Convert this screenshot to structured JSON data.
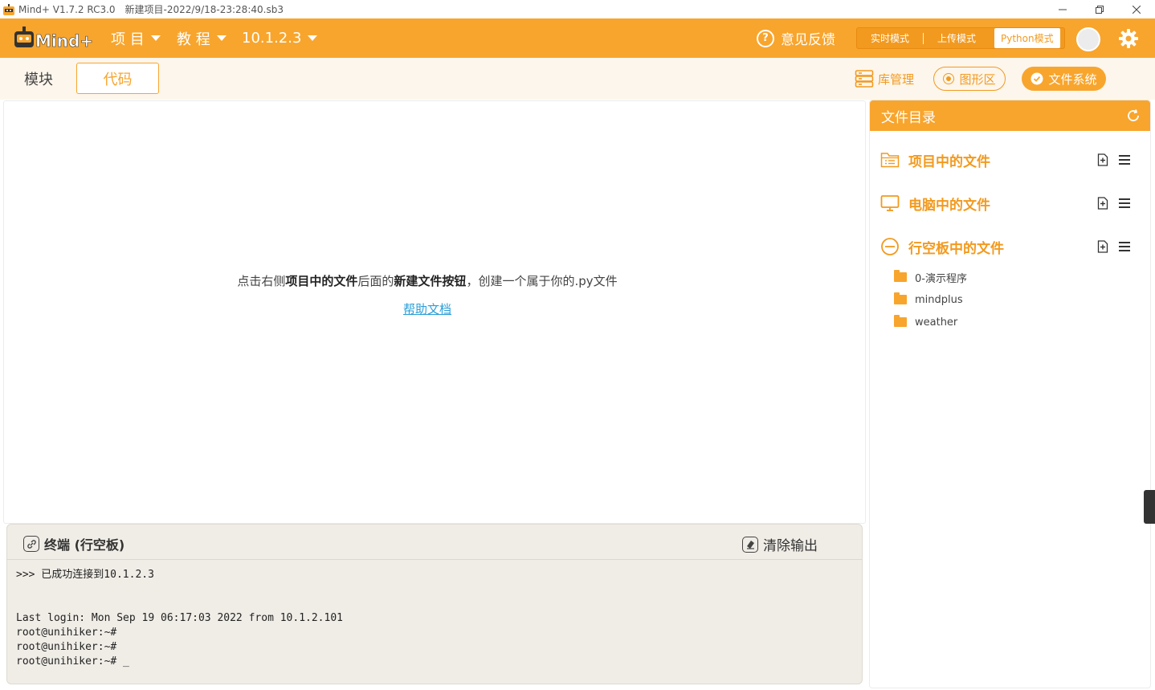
{
  "titlebar": {
    "app_title": "Mind+ V1.7.2 RC3.0",
    "file_title": "新建项目-2022/9/18-23:28:40.sb3"
  },
  "menubar": {
    "project_label": "项 目",
    "tutorial_label": "教 程",
    "device_label": "10.1.2.3",
    "feedback_label": "意见反馈",
    "modes": {
      "realtime": "实时模式",
      "upload": "上传模式",
      "python": "Python模式"
    },
    "active_mode": "python",
    "accent_color": "#f8a52d"
  },
  "tabs": {
    "blocks_label": "模块",
    "code_label": "代码",
    "active": "code"
  },
  "tools": {
    "library_label": "库管理",
    "shape_label": "图形区",
    "filesystem_label": "文件系统"
  },
  "editor": {
    "hint_prefix": "点击右侧",
    "hint_bold1": "项目中的文件",
    "hint_mid": "后面的",
    "hint_bold2": "新建文件按钮",
    "hint_suffix": "，创建一个属于你的.py文件",
    "help_link": "帮助文档"
  },
  "terminal": {
    "title": "终端 (行空板)",
    "clear_label": "清除输出",
    "output": ">>> 已成功连接到10.1.2.3\n\n\nLast login: Mon Sep 19 06:17:03 2022 from 10.1.2.101\nroot@unihiker:~#\nroot@unihiker:~#\nroot@unihiker:~# _"
  },
  "filepanel": {
    "title": "文件目录",
    "sections": [
      {
        "label": "项目中的文件",
        "icon": "list-folder-icon"
      },
      {
        "label": "电脑中的文件",
        "icon": "monitor-icon"
      },
      {
        "label": "行空板中的文件",
        "icon": "board-icon"
      }
    ],
    "board_folders": [
      "0-演示程序",
      "mindplus",
      "weather"
    ]
  }
}
